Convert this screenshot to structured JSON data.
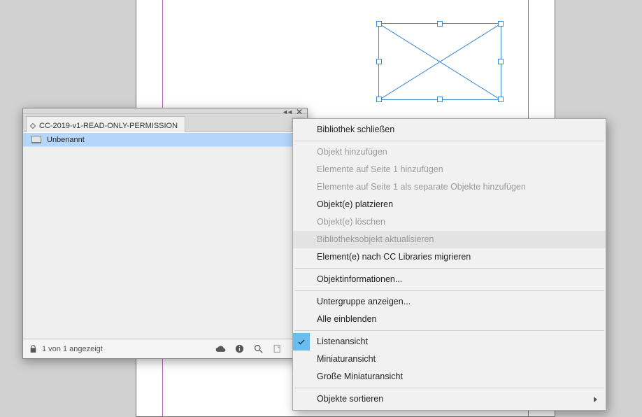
{
  "panel": {
    "tab_title": "CC-2019-v1-READ-ONLY-PERMISSION",
    "item_label": "Unbenannt",
    "status_text": "1 von 1 angezeigt"
  },
  "context_menu": {
    "items": [
      {
        "label": "Bibliothek schließen",
        "enabled": true
      },
      {
        "sep": true
      },
      {
        "label": "Objekt hinzufügen",
        "enabled": false
      },
      {
        "label": "Elemente auf Seite 1 hinzufügen",
        "enabled": false
      },
      {
        "label": "Elemente auf Seite 1 als separate Objekte hinzufügen",
        "enabled": false
      },
      {
        "label": "Objekt(e) platzieren",
        "enabled": true
      },
      {
        "label": "Objekt(e) löschen",
        "enabled": false
      },
      {
        "label": "Bibliotheksobjekt aktualisieren",
        "enabled": false,
        "hover": true
      },
      {
        "label": "Element(e) nach CC Libraries migrieren",
        "enabled": true
      },
      {
        "sep": true
      },
      {
        "label": "Objektinformationen...",
        "enabled": true
      },
      {
        "sep": true
      },
      {
        "label": "Untergruppe anzeigen...",
        "enabled": true
      },
      {
        "label": "Alle einblenden",
        "enabled": true
      },
      {
        "sep": true
      },
      {
        "label": "Listenansicht",
        "enabled": true,
        "checked": true
      },
      {
        "label": "Miniaturansicht",
        "enabled": true
      },
      {
        "label": "Große Miniaturansicht",
        "enabled": true
      },
      {
        "sep": true
      },
      {
        "label": "Objekte sortieren",
        "enabled": true,
        "submenu": true
      }
    ]
  }
}
